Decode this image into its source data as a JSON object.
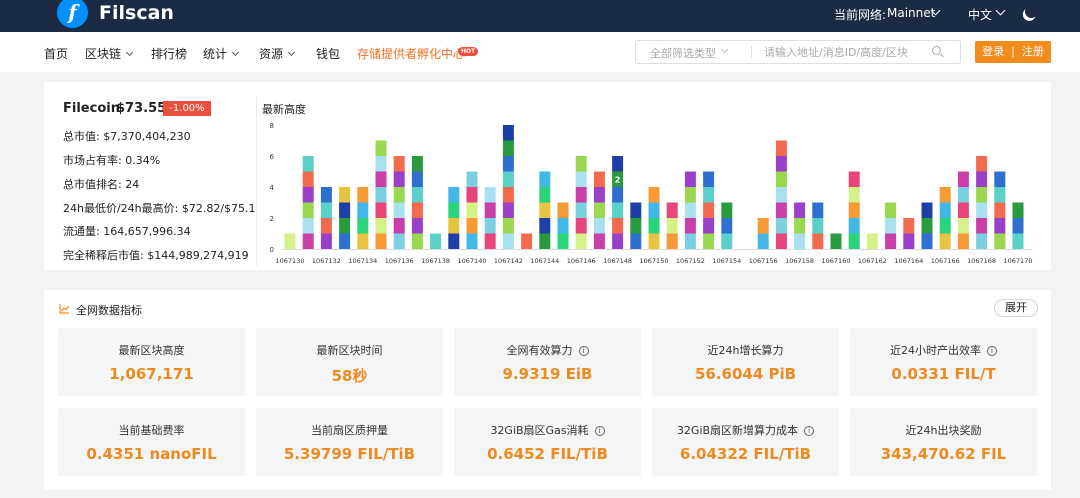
{
  "header": {
    "brand": "Filscan",
    "logo_glyph": "f",
    "network_label": "当前网络:",
    "network_value": "Mainnet",
    "language": "中文"
  },
  "nav": {
    "items": [
      "首页",
      "区块链",
      "排行榜",
      "统计",
      "资源",
      "钱包"
    ],
    "highlight": "存储提供者孵化中心",
    "hot_badge": "HOT",
    "search_type": "全部筛选类型",
    "search_placeholder": "请输入地址/消息ID/高度/区块",
    "login": "登录",
    "register": "注册",
    "login_sep": "|"
  },
  "market": {
    "coin": "Filecoin",
    "price": "$73.55",
    "change": "-1.00%",
    "stats": [
      "总市值: $7,370,404,230",
      "市场占有率: 0.34%",
      "总市值排名: 24",
      "24h最低价/24h最高价: $72.82/$75.1",
      "流通量: 164,657,996.34",
      "完全稀释后市值: $144,989,274,919"
    ]
  },
  "chart_data": {
    "type": "bar",
    "title": "最新高度",
    "xlabel": "",
    "ylabel": "",
    "ylim": [
      0,
      8
    ],
    "yticks": [
      0,
      2,
      4,
      6,
      8
    ],
    "grid": false,
    "categories": [
      "1067130",
      "1067131",
      "1067132",
      "1067133",
      "1067134",
      "1067135",
      "1067136",
      "1067137",
      "1067138",
      "1067139",
      "1067140",
      "1067141",
      "1067142",
      "1067143",
      "1067144",
      "1067145",
      "1067146",
      "1067147",
      "1067148",
      "1067149",
      "1067150",
      "1067151",
      "1067152",
      "1067153",
      "1067154",
      "1067155",
      "1067156",
      "1067157",
      "1067158",
      "1067159",
      "1067160",
      "1067161",
      "1067162",
      "1067163",
      "1067164",
      "1067165",
      "1067166",
      "1067167",
      "1067168",
      "1067169",
      "1067170"
    ],
    "x_tick_labels": [
      "1067130",
      "1067132",
      "1067134",
      "1067136",
      "1067138",
      "1067140",
      "1067142",
      "1067144",
      "1067146",
      "1067148",
      "1067150",
      "1067152",
      "1067154",
      "1067156",
      "1067158",
      "1067160",
      "1067162",
      "1067164",
      "1067166",
      "1067168",
      "1067170"
    ],
    "values": [
      1,
      6,
      4,
      4,
      4,
      7,
      6,
      6,
      1,
      4,
      5,
      4,
      8,
      1,
      5,
      3,
      6,
      5,
      6,
      3,
      4,
      3,
      5,
      5,
      3,
      0,
      2,
      7,
      3,
      3,
      1,
      5,
      1,
      3,
      2,
      3,
      4,
      5,
      6,
      5,
      3
    ],
    "annotations": [
      {
        "category": "1067148",
        "level": 5,
        "text": "2"
      }
    ],
    "colors": {
      "palette": [
        "#1f3fa8",
        "#7ad0e0",
        "#2f6fd0",
        "#d6f08a",
        "#f26b4f",
        "#41b8e8",
        "#9ad84f",
        "#e8c33f",
        "#c93fa8",
        "#2a9a3f",
        "#e8467a",
        "#5ad0c8",
        "#f59a34",
        "#9a3fc9",
        "#2ad47a",
        "#a8e0f0"
      ]
    }
  },
  "metrics": {
    "title": "全网数据指标",
    "expand": "展开",
    "info_glyph": "i",
    "tiles": [
      {
        "label": "最新区块高度",
        "value": "1,067,171",
        "info": false
      },
      {
        "label": "最新区块时间",
        "value": "58秒",
        "info": false
      },
      {
        "label": "全网有效算力",
        "value": "9.9319 EiB",
        "info": true
      },
      {
        "label": "近24h增长算力",
        "value": "56.6044 PiB",
        "info": false
      },
      {
        "label": "近24小时产出效率",
        "value": "0.0331 FIL/T",
        "info": true
      },
      {
        "label": "当前基础费率",
        "value": "0.4351 nanoFIL",
        "info": false
      },
      {
        "label": "当前扇区质押量",
        "value": "5.39799 FIL/TiB",
        "info": false
      },
      {
        "label": "32GiB扇区Gas消耗",
        "value": "0.6452 FIL/TiB",
        "info": true
      },
      {
        "label": "32GiB扇区新增算力成本",
        "value": "6.04322 FIL/TiB",
        "info": true
      },
      {
        "label": "近24h出块奖励",
        "value": "343,470.62 FIL",
        "info": false
      }
    ]
  }
}
